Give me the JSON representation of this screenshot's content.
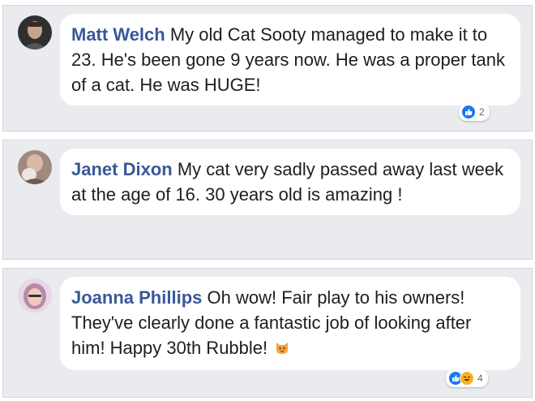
{
  "comments": [
    {
      "author": "Matt Welch",
      "text": "My old Cat Sooty managed to make it to 23. He's been gone 9 years now. He was a proper tank of a cat. He was HUGE!",
      "reaction_count": "2",
      "reactions": [
        "like-icon"
      ]
    },
    {
      "author": "Janet Dixon",
      "text": "My cat very sadly passed away last week at the age of 16. 30 years old is amazing !"
    },
    {
      "author": "Joanna Phillips",
      "text": "Oh wow! Fair play to his owners! They've clearly done a fantastic job of looking after him! Happy 30th Rubble!",
      "emoji": "cat-face-emoji",
      "reaction_count": "4",
      "reactions": [
        "like-icon",
        "haha-icon"
      ]
    }
  ],
  "colors": {
    "author": "#385898",
    "like": "#1877f2",
    "haha": "#f7b125",
    "card_background": "#e9ebee"
  }
}
